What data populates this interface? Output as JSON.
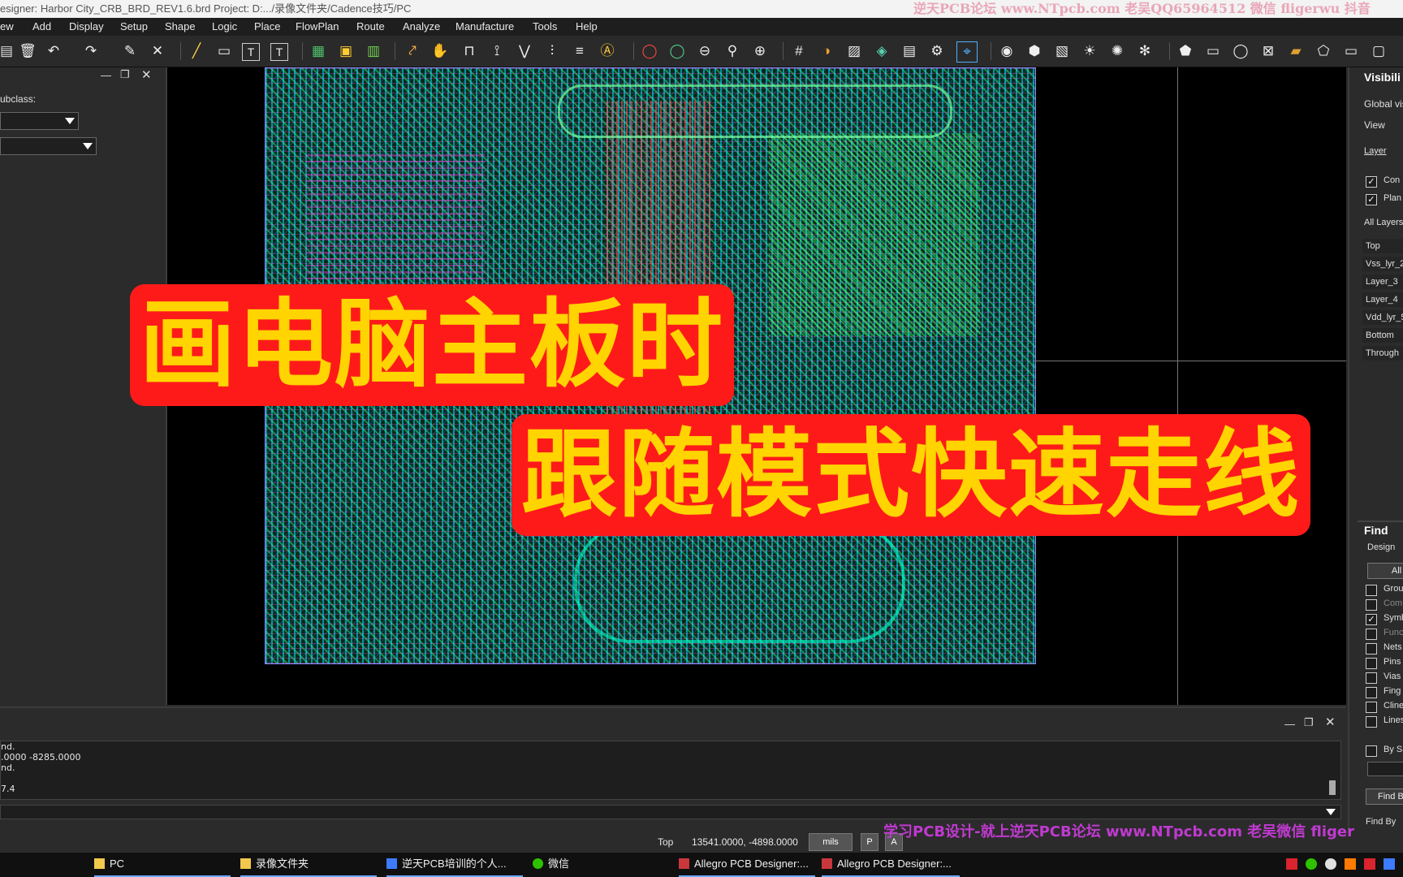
{
  "window": {
    "title": "esigner: Harbor City_CRB_BRD_REV1.6.brd  Project: D:.../录像文件夹/Cadence技巧/PC",
    "watermark_top": "逆天PCB论坛 www.NTpcb.com 老吴QQ65964512  微信 fligerwu 抖音"
  },
  "menu": [
    "ew",
    "Add",
    "Display",
    "Setup",
    "Shape",
    "Logic",
    "Place",
    "FlowPlan",
    "Route",
    "Analyze",
    "Manufacture",
    "Tools",
    "Help"
  ],
  "left_panel": {
    "subclass_label": "ubclass:"
  },
  "overlay": {
    "line1": "画电脑主板时",
    "line2": "跟随模式快速走线"
  },
  "visibility": {
    "title": "Visibili",
    "global": "Global vis",
    "view": "View",
    "layer_header": "Layer",
    "conductors": "Con",
    "planes": "Plan",
    "all_layers": "All Layers",
    "layers": [
      "Top",
      "Vss_lyr_2",
      "Layer_3",
      "Layer_4",
      "Vdd_lyr_5",
      "Bottom",
      "Through"
    ]
  },
  "find": {
    "title": "Find",
    "design": "Design",
    "all_btn": "All",
    "items": [
      {
        "label": "Grou",
        "checked": false,
        "dim": false
      },
      {
        "label": "Com",
        "checked": false,
        "dim": true
      },
      {
        "label": "Symb",
        "checked": true,
        "dim": false
      },
      {
        "label": "Func",
        "checked": false,
        "dim": true
      },
      {
        "label": "Nets",
        "checked": false,
        "dim": false
      },
      {
        "label": "Pins",
        "checked": false,
        "dim": false
      },
      {
        "label": "Vias",
        "checked": false,
        "dim": false
      },
      {
        "label": "Fing",
        "checked": false,
        "dim": false
      },
      {
        "label": "Cline",
        "checked": false,
        "dim": false
      },
      {
        "label": "Lines",
        "checked": false,
        "dim": false
      }
    ],
    "by_label": "By Sa",
    "find_btn": "Find B",
    "find_by": "Find By"
  },
  "command_log": [
    "nd.",
    ".0000 -8285.0000",
    "nd.",
    "",
    "7.4"
  ],
  "status": {
    "layer": "Top",
    "coords": "13541.0000, -4898.0000",
    "units": "mils",
    "p_btn": "P",
    "a_btn": "A"
  },
  "watermark_bottom": "学习PCB设计-就上逆天PCB论坛 www.NTpcb.com 老吴微信 fliger",
  "taskbar": [
    {
      "label": "PC",
      "icon": "folder-icon",
      "active": true
    },
    {
      "label": "录像文件夹",
      "icon": "folder-icon",
      "active": true
    },
    {
      "label": "逆天PCB培训的个人...",
      "icon": "browser-icon",
      "active": true
    },
    {
      "label": "微信",
      "icon": "wechat-icon",
      "active": false
    },
    {
      "label": "Allegro PCB Designer:...",
      "icon": "allegro-icon",
      "active": true
    },
    {
      "label": "Allegro PCB Designer:...",
      "icon": "allegro-icon",
      "active": true
    }
  ]
}
